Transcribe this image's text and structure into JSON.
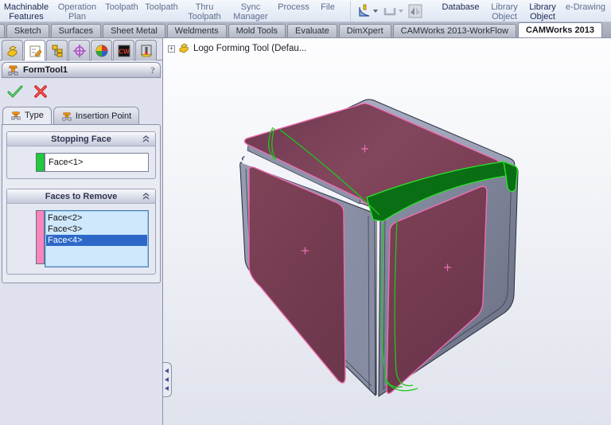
{
  "menubar": {
    "items": [
      {
        "label": "Machinable Features",
        "enabled": true
      },
      {
        "label": "Operation Plan",
        "enabled": false
      },
      {
        "label": "Toolpath",
        "enabled": false
      },
      {
        "label": "Toolpath",
        "enabled": false
      },
      {
        "label": "Thru Toolpath",
        "enabled": false
      },
      {
        "label": "Sync Manager",
        "enabled": false
      },
      {
        "label": "Process",
        "enabled": false
      },
      {
        "label": "File",
        "enabled": false
      }
    ],
    "icons": [
      {
        "name": "form-tool-icon",
        "enabled": true
      },
      {
        "name": "die-channel-icon",
        "enabled": false
      },
      {
        "name": "flip-section-icon",
        "enabled": false
      }
    ],
    "right_items": [
      {
        "label": "Database",
        "enabled": true
      },
      {
        "label": "Library Object",
        "enabled": false
      },
      {
        "label": "Library Object",
        "enabled": true
      },
      {
        "label": "e-Drawing",
        "enabled": false
      }
    ]
  },
  "tabbar": {
    "tabs": [
      {
        "label": "Sketch",
        "active": false
      },
      {
        "label": "Surfaces",
        "active": false
      },
      {
        "label": "Sheet Metal",
        "active": false
      },
      {
        "label": "Weldments",
        "active": false
      },
      {
        "label": "Mold Tools",
        "active": false
      },
      {
        "label": "Evaluate",
        "active": false
      },
      {
        "label": "DimXpert",
        "active": false
      },
      {
        "label": "CAMWorks 2013-WorkFlow",
        "active": false
      },
      {
        "label": "CAMWorks 2013",
        "active": true
      }
    ]
  },
  "property_manager": {
    "title": "FormTool1",
    "help_glyph": "?",
    "manager_tabs": [
      {
        "name": "feature-manager"
      },
      {
        "name": "property-manager",
        "active": true
      },
      {
        "name": "configuration-manager"
      },
      {
        "name": "dimxpert-manager"
      },
      {
        "name": "display-manager"
      },
      {
        "name": "camworks-feature-tree"
      },
      {
        "name": "camworks-operation-tree"
      }
    ],
    "tabs": [
      {
        "label": "Type",
        "active": true
      },
      {
        "label": "Insertion Point",
        "active": false
      }
    ],
    "groups": {
      "stopping_face": {
        "title": "Stopping Face",
        "value": "Face<1>",
        "swatch_color": "#1ecb38"
      },
      "faces_to_remove": {
        "title": "Faces to Remove",
        "swatch_color": "#f885bd",
        "items": [
          "Face<2>",
          "Face<3>",
          "Face<4>"
        ],
        "selected_index": 2
      }
    }
  },
  "viewport": {
    "feature_tree_label": "Logo Forming Tool  (Defau...",
    "expand_glyph": "+",
    "model": "logo-forming-tool-cube",
    "colors": {
      "face_maroon": "#7c4055",
      "outline_pink": "#ee6fb3",
      "stopping_face_green": "#0a6e14",
      "selection_green": "#2ce32c",
      "body_gray": "#9096ab"
    }
  }
}
